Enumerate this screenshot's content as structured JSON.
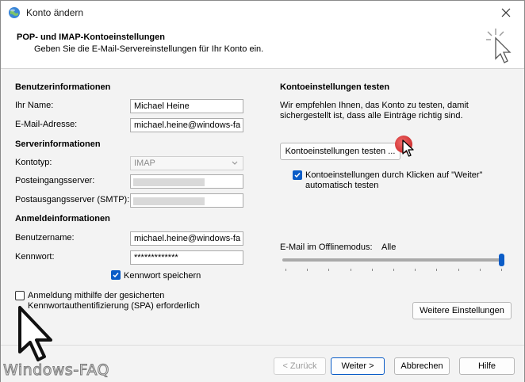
{
  "window": {
    "title": "Konto ändern"
  },
  "header": {
    "title": "POP- und IMAP-Kontoeinstellungen",
    "subtitle": "Geben Sie die E-Mail-Servereinstellungen für Ihr Konto ein."
  },
  "left": {
    "user_section": "Benutzerinformationen",
    "name_label": "Ihr Name:",
    "name_value": "Michael Heine",
    "email_label": "E-Mail-Adresse:",
    "email_value": "michael.heine@windows-fa",
    "server_section": "Serverinformationen",
    "account_type_label": "Kontotyp:",
    "account_type_value": "IMAP",
    "incoming_label": "Posteingangsserver:",
    "outgoing_label": "Postausgangsserver (SMTP):",
    "login_section": "Anmeldeinformationen",
    "username_label": "Benutzername:",
    "username_value": "michael.heine@windows-fa",
    "password_label": "Kennwort:",
    "password_value": "*************",
    "remember_password": {
      "label": "Kennwort speichern",
      "checked": true
    },
    "spa": {
      "label_line1": "Anmeldung mithilfe der gesicherten",
      "label_line2": "Kennwortauthentifizierung (SPA) erforderlich",
      "checked": false
    }
  },
  "right": {
    "test_section": "Kontoeinstellungen testen",
    "test_desc_line1": "Wir empfehlen Ihnen, das Konto zu testen, damit",
    "test_desc_line2": "sichergestellt ist, dass alle Einträge richtig sind.",
    "test_button": "Kontoeinstellungen testen ...",
    "auto_test": {
      "label_line1": "Kontoeinstellungen durch Klicken auf \"Weiter\"",
      "label_line2": "automatisch testen",
      "checked": true
    },
    "offline_label": "E-Mail im Offlinemodus:",
    "offline_value": "Alle",
    "offline_level_percent": 100,
    "more_settings_button": "Weitere Einstellungen"
  },
  "footer": {
    "back": "< Zurück",
    "next": "Weiter >",
    "cancel": "Abbrechen",
    "help": "Hilfe"
  },
  "watermark": "Windows-FAQ",
  "colors": {
    "accent": "#0a5cc7",
    "background": "#f3f3f3",
    "annotation_dot": "#d32f2f"
  }
}
